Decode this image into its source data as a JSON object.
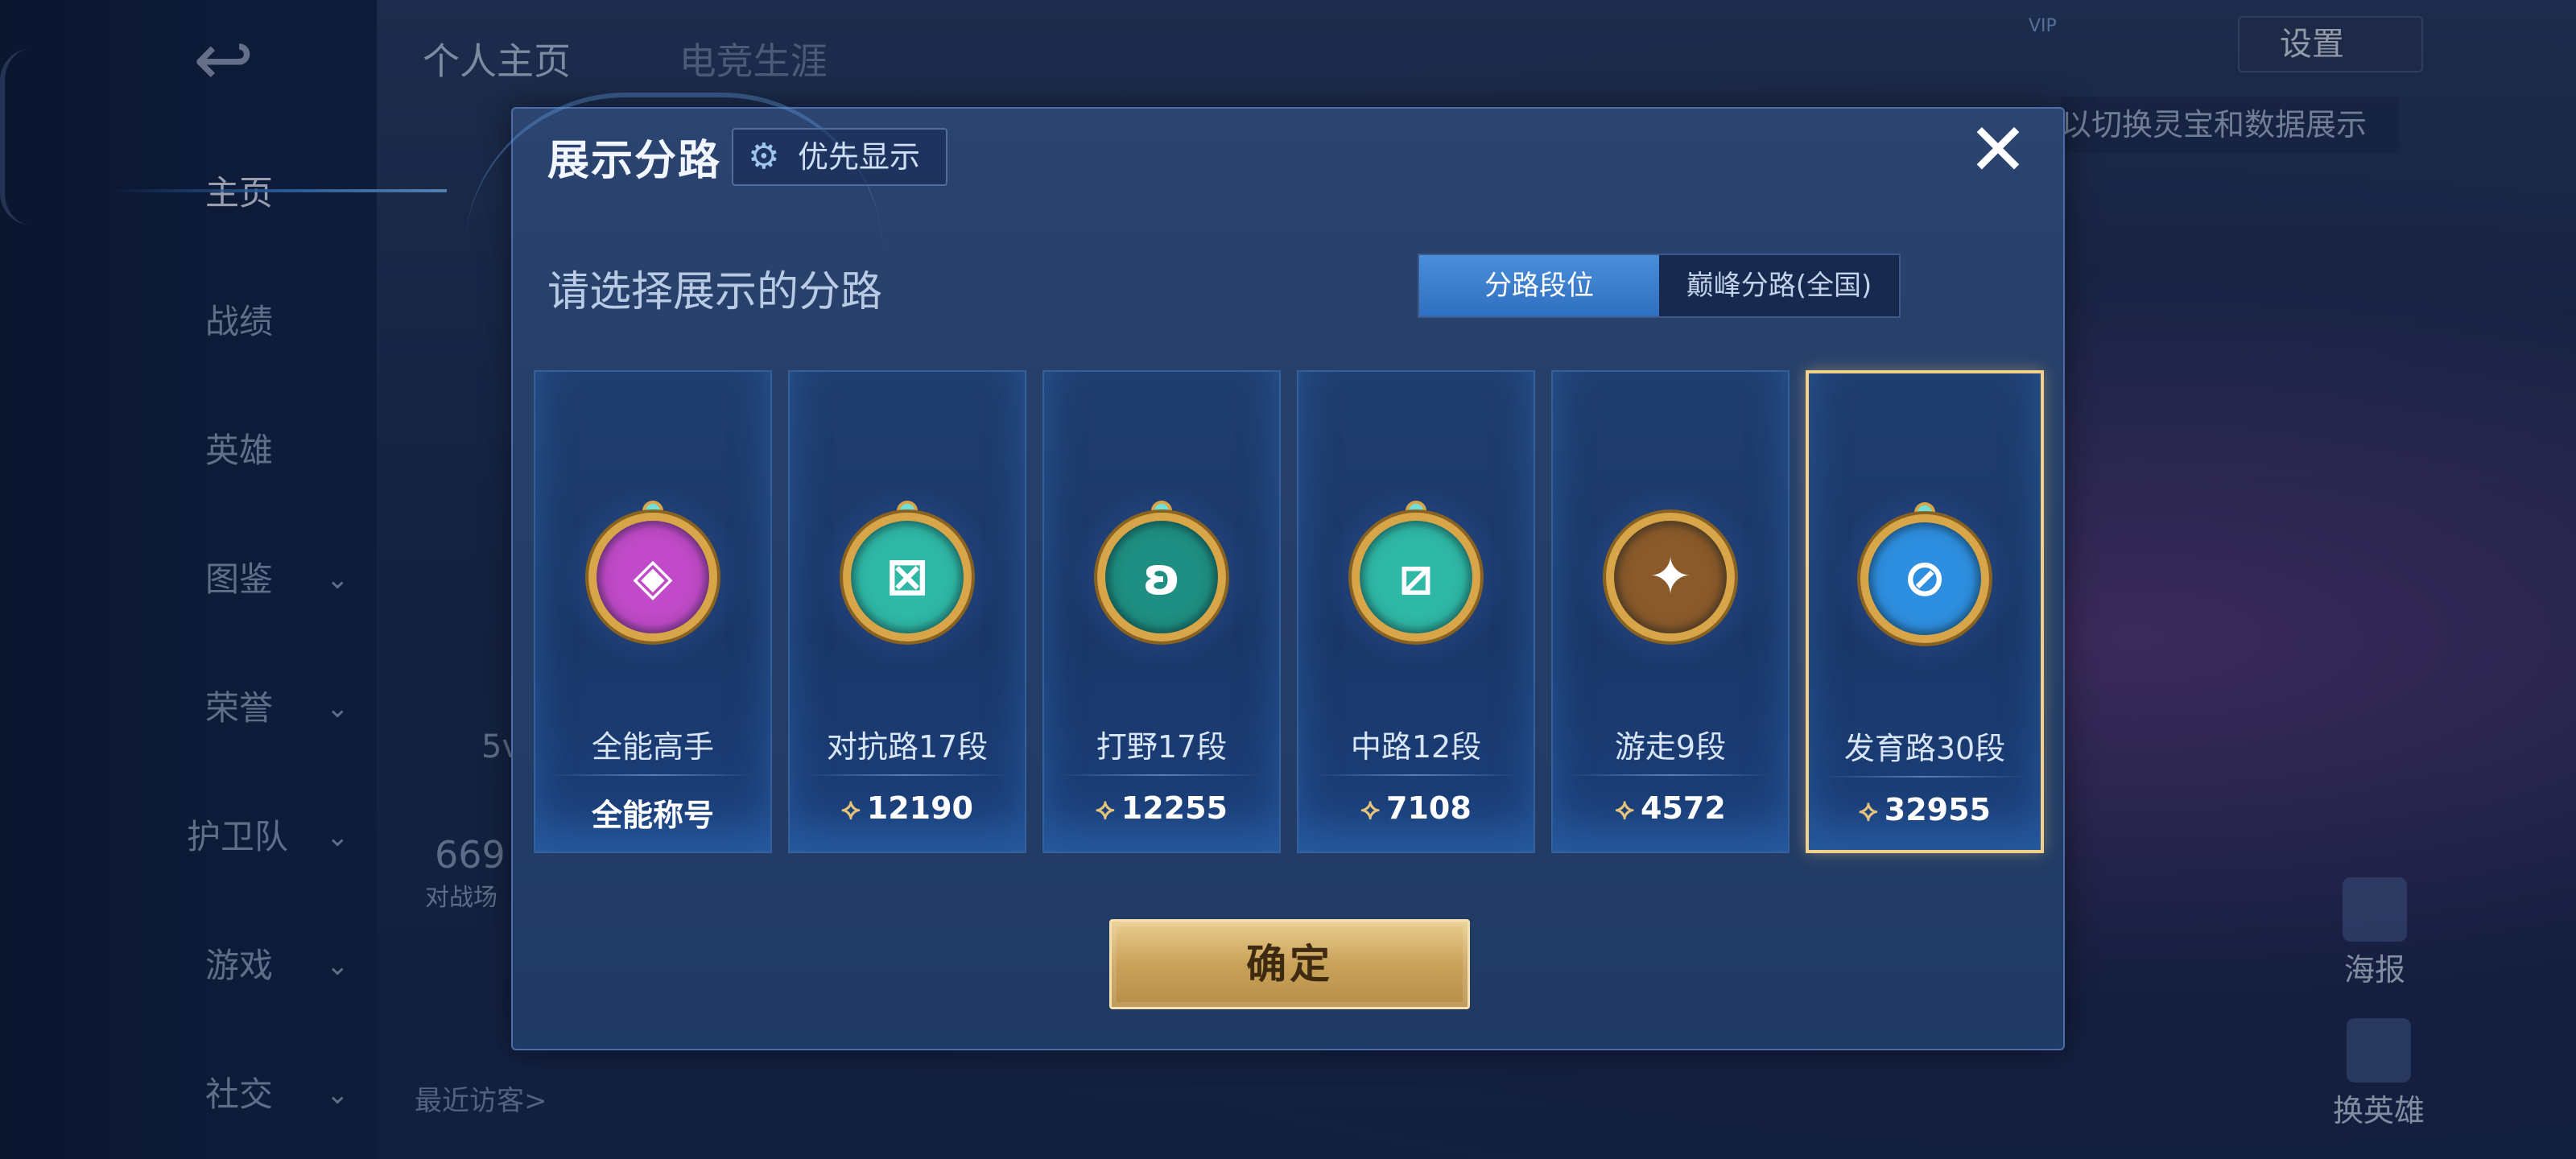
{
  "sidebar": {
    "items": [
      {
        "label": "主页",
        "active": true,
        "has_chevron": false
      },
      {
        "label": "战绩",
        "active": false,
        "has_chevron": false
      },
      {
        "label": "英雄",
        "active": false,
        "has_chevron": false
      },
      {
        "label": "图鉴",
        "active": false,
        "has_chevron": true
      },
      {
        "label": "荣誉",
        "active": false,
        "has_chevron": true
      },
      {
        "label": "护卫队",
        "active": false,
        "has_chevron": true
      },
      {
        "label": "游戏",
        "active": false,
        "has_chevron": true
      },
      {
        "label": "社交",
        "active": false,
        "has_chevron": true
      }
    ]
  },
  "background": {
    "tabs": [
      "个人主页",
      "电竞生涯"
    ],
    "settings_label": "设置",
    "vip_label": "VIP",
    "hint_text": "以切换灵宝和数据展示",
    "fragment_5v": "5v",
    "fragment_669": "669",
    "fragment_battle": "对战场",
    "visitors_label": "最近访客>",
    "poster_label": "海报",
    "switch_hero_label": "换英雄"
  },
  "modal": {
    "title": "展示分路",
    "priority_label": "优先显示",
    "close_label": "✕",
    "prompt": "请选择展示的分路",
    "toggle": {
      "options": [
        "分路段位",
        "巅峰分路(全国)"
      ],
      "selected": "分路段位"
    },
    "cards": [
      {
        "name": "全能高手",
        "value": "全能称号",
        "badge_icon": "all-round-emblem",
        "badge_color": "#c04ac8",
        "badge_glyph": "◈",
        "show_points": false,
        "selected": false
      },
      {
        "name": "对抗路17段",
        "value": "12190",
        "badge_icon": "clash-lane-emblem",
        "badge_color": "#2fb8a6",
        "badge_glyph": "⊠",
        "show_points": true,
        "selected": false
      },
      {
        "name": "打野17段",
        "value": "12255",
        "badge_icon": "jungle-emblem",
        "badge_color": "#1e8f82",
        "badge_glyph": "ʚ",
        "show_points": true,
        "selected": false
      },
      {
        "name": "中路12段",
        "value": "7108",
        "badge_icon": "mid-lane-emblem",
        "badge_color": "#2fb8a6",
        "badge_glyph": "⧄",
        "show_points": true,
        "selected": false
      },
      {
        "name": "游走9段",
        "value": "4572",
        "badge_icon": "roam-emblem",
        "badge_color": "#8a5a2a",
        "badge_glyph": "✦",
        "show_points": true,
        "selected": false
      },
      {
        "name": "发育路30段",
        "value": "32955",
        "badge_icon": "farm-lane-emblem",
        "badge_color": "#2e8fe0",
        "badge_glyph": "⊘",
        "show_points": true,
        "selected": true
      }
    ],
    "confirm_label": "确定"
  },
  "colors": {
    "accent_blue": "#3a7fd0",
    "selected_border": "#f3d08a",
    "confirm_gold": "#c9a25a"
  }
}
